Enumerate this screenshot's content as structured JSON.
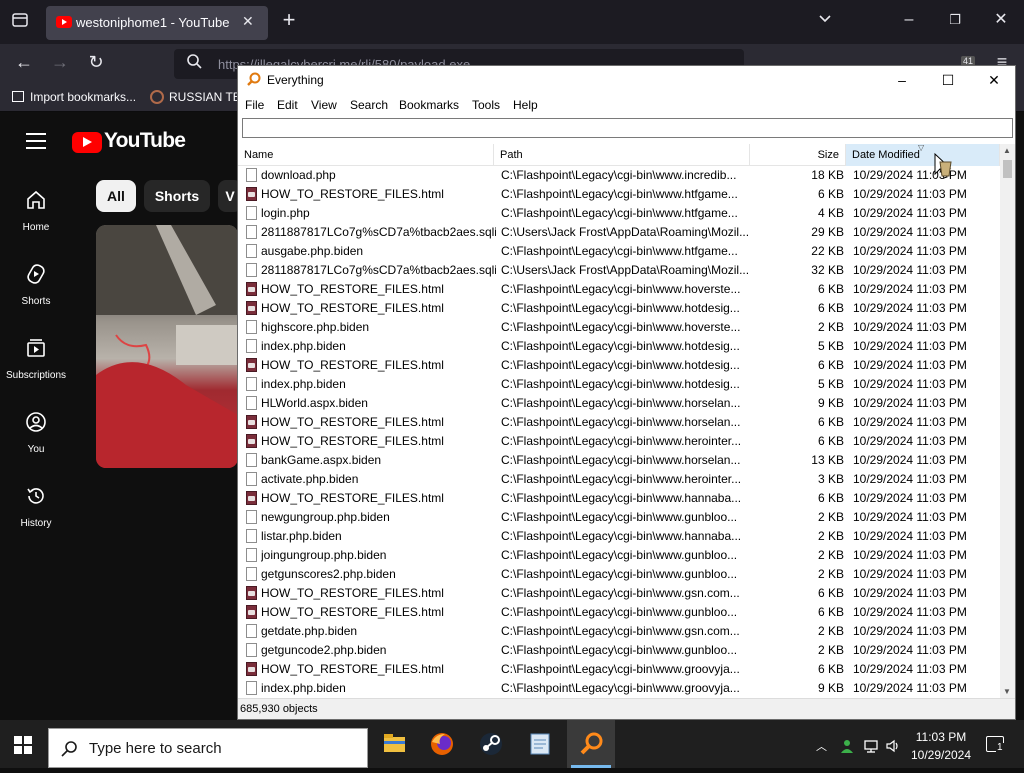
{
  "browser": {
    "tab_title": "westoniphome1 - YouTube",
    "url": "https://illegalcybercri.me/rli/580/payload.exe",
    "bookmarks": [
      "Import bookmarks...",
      "RUSSIAN TES"
    ],
    "extension_badge": "41"
  },
  "youtube": {
    "logo_text": "YouTube",
    "chips": [
      "All",
      "Shorts",
      "V"
    ],
    "sidebar": [
      "Home",
      "Shorts",
      "Subscriptions",
      "You",
      "History"
    ]
  },
  "everything": {
    "window_title": "Everything",
    "menu": [
      "File",
      "Edit",
      "View",
      "Search",
      "Bookmarks",
      "Tools",
      "Help"
    ],
    "search_value": "",
    "columns": {
      "name": "Name",
      "path": "Path",
      "size": "Size",
      "date": "Date Modified"
    },
    "rows": [
      {
        "name": "download.php",
        "path": "C:\\Flashpoint\\Legacy\\cgi-bin\\www.incredib...",
        "size": "18 KB",
        "date": "10/29/2024 11:03 PM",
        "icon": "file-icon"
      },
      {
        "name": "HOW_TO_RESTORE_FILES.html",
        "path": "C:\\Flashpoint\\Legacy\\cgi-bin\\www.htfgame...",
        "size": "6 KB",
        "date": "10/29/2024 11:03 PM",
        "icon": "html-file-icon"
      },
      {
        "name": "login.php",
        "path": "C:\\Flashpoint\\Legacy\\cgi-bin\\www.htfgame...",
        "size": "4 KB",
        "date": "10/29/2024 11:03 PM",
        "icon": "file-icon"
      },
      {
        "name": "2811887817LCo7g%sCD7a%tbacb2aes.sqli...",
        "path": "C:\\Users\\Jack Frost\\AppData\\Roaming\\Mozil...",
        "size": "29 KB",
        "date": "10/29/2024 11:03 PM",
        "icon": "file-icon"
      },
      {
        "name": "ausgabe.php.biden",
        "path": "C:\\Flashpoint\\Legacy\\cgi-bin\\www.htfgame...",
        "size": "22 KB",
        "date": "10/29/2024 11:03 PM",
        "icon": "file-icon"
      },
      {
        "name": "2811887817LCo7g%sCD7a%tbacb2aes.sqli...",
        "path": "C:\\Users\\Jack Frost\\AppData\\Roaming\\Mozil...",
        "size": "32 KB",
        "date": "10/29/2024 11:03 PM",
        "icon": "file-icon"
      },
      {
        "name": "HOW_TO_RESTORE_FILES.html",
        "path": "C:\\Flashpoint\\Legacy\\cgi-bin\\www.hoverste...",
        "size": "6 KB",
        "date": "10/29/2024 11:03 PM",
        "icon": "html-file-icon"
      },
      {
        "name": "HOW_TO_RESTORE_FILES.html",
        "path": "C:\\Flashpoint\\Legacy\\cgi-bin\\www.hotdesig...",
        "size": "6 KB",
        "date": "10/29/2024 11:03 PM",
        "icon": "html-file-icon"
      },
      {
        "name": "highscore.php.biden",
        "path": "C:\\Flashpoint\\Legacy\\cgi-bin\\www.hoverste...",
        "size": "2 KB",
        "date": "10/29/2024 11:03 PM",
        "icon": "file-icon"
      },
      {
        "name": "index.php.biden",
        "path": "C:\\Flashpoint\\Legacy\\cgi-bin\\www.hotdesig...",
        "size": "5 KB",
        "date": "10/29/2024 11:03 PM",
        "icon": "file-icon"
      },
      {
        "name": "HOW_TO_RESTORE_FILES.html",
        "path": "C:\\Flashpoint\\Legacy\\cgi-bin\\www.hotdesig...",
        "size": "6 KB",
        "date": "10/29/2024 11:03 PM",
        "icon": "html-file-icon"
      },
      {
        "name": "index.php.biden",
        "path": "C:\\Flashpoint\\Legacy\\cgi-bin\\www.hotdesig...",
        "size": "5 KB",
        "date": "10/29/2024 11:03 PM",
        "icon": "file-icon"
      },
      {
        "name": "HLWorld.aspx.biden",
        "path": "C:\\Flashpoint\\Legacy\\cgi-bin\\www.horselan...",
        "size": "9 KB",
        "date": "10/29/2024 11:03 PM",
        "icon": "file-icon"
      },
      {
        "name": "HOW_TO_RESTORE_FILES.html",
        "path": "C:\\Flashpoint\\Legacy\\cgi-bin\\www.horselan...",
        "size": "6 KB",
        "date": "10/29/2024 11:03 PM",
        "icon": "html-file-icon"
      },
      {
        "name": "HOW_TO_RESTORE_FILES.html",
        "path": "C:\\Flashpoint\\Legacy\\cgi-bin\\www.herointer...",
        "size": "6 KB",
        "date": "10/29/2024 11:03 PM",
        "icon": "html-file-icon"
      },
      {
        "name": "bankGame.aspx.biden",
        "path": "C:\\Flashpoint\\Legacy\\cgi-bin\\www.horselan...",
        "size": "13 KB",
        "date": "10/29/2024 11:03 PM",
        "icon": "file-icon"
      },
      {
        "name": "activate.php.biden",
        "path": "C:\\Flashpoint\\Legacy\\cgi-bin\\www.herointer...",
        "size": "3 KB",
        "date": "10/29/2024 11:03 PM",
        "icon": "file-icon"
      },
      {
        "name": "HOW_TO_RESTORE_FILES.html",
        "path": "C:\\Flashpoint\\Legacy\\cgi-bin\\www.hannaba...",
        "size": "6 KB",
        "date": "10/29/2024 11:03 PM",
        "icon": "html-file-icon"
      },
      {
        "name": "newgungroup.php.biden",
        "path": "C:\\Flashpoint\\Legacy\\cgi-bin\\www.gunbloo...",
        "size": "2 KB",
        "date": "10/29/2024 11:03 PM",
        "icon": "file-icon"
      },
      {
        "name": "listar.php.biden",
        "path": "C:\\Flashpoint\\Legacy\\cgi-bin\\www.hannaba...",
        "size": "2 KB",
        "date": "10/29/2024 11:03 PM",
        "icon": "file-icon"
      },
      {
        "name": "joingungroup.php.biden",
        "path": "C:\\Flashpoint\\Legacy\\cgi-bin\\www.gunbloo...",
        "size": "2 KB",
        "date": "10/29/2024 11:03 PM",
        "icon": "file-icon"
      },
      {
        "name": "getgunscores2.php.biden",
        "path": "C:\\Flashpoint\\Legacy\\cgi-bin\\www.gunbloo...",
        "size": "2 KB",
        "date": "10/29/2024 11:03 PM",
        "icon": "file-icon"
      },
      {
        "name": "HOW_TO_RESTORE_FILES.html",
        "path": "C:\\Flashpoint\\Legacy\\cgi-bin\\www.gsn.com...",
        "size": "6 KB",
        "date": "10/29/2024 11:03 PM",
        "icon": "html-file-icon"
      },
      {
        "name": "HOW_TO_RESTORE_FILES.html",
        "path": "C:\\Flashpoint\\Legacy\\cgi-bin\\www.gunbloo...",
        "size": "6 KB",
        "date": "10/29/2024 11:03 PM",
        "icon": "html-file-icon"
      },
      {
        "name": "getdate.php.biden",
        "path": "C:\\Flashpoint\\Legacy\\cgi-bin\\www.gsn.com...",
        "size": "2 KB",
        "date": "10/29/2024 11:03 PM",
        "icon": "file-icon"
      },
      {
        "name": "getguncode2.php.biden",
        "path": "C:\\Flashpoint\\Legacy\\cgi-bin\\www.gunbloo...",
        "size": "2 KB",
        "date": "10/29/2024 11:03 PM",
        "icon": "file-icon"
      },
      {
        "name": "HOW_TO_RESTORE_FILES.html",
        "path": "C:\\Flashpoint\\Legacy\\cgi-bin\\www.groovyja...",
        "size": "6 KB",
        "date": "10/29/2024 11:03 PM",
        "icon": "html-file-icon"
      },
      {
        "name": "index.php.biden",
        "path": "C:\\Flashpoint\\Legacy\\cgi-bin\\www.groovyja...",
        "size": "9 KB",
        "date": "10/29/2024 11:03 PM",
        "icon": "file-icon"
      }
    ],
    "status": "685,930 objects"
  },
  "taskbar": {
    "search_placeholder": "Type here to search",
    "time": "11:03 PM",
    "date": "10/29/2024",
    "notification_count": "1"
  },
  "colors": {
    "youtube_red": "#ff0000",
    "browser_dark": "#1c1b22",
    "selected_column": "#d9ebf9"
  }
}
